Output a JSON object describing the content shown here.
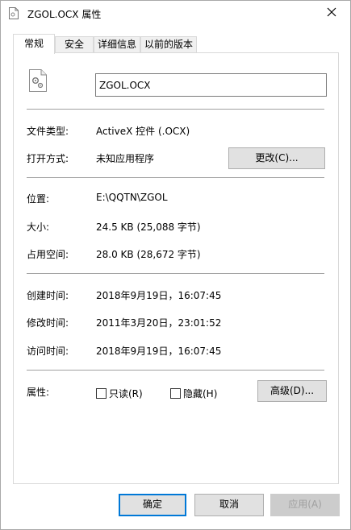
{
  "window": {
    "title": "ZGOL.OCX 属性",
    "close_icon": "close-icon"
  },
  "tabs": [
    {
      "label": "常规",
      "active": true
    },
    {
      "label": "安全",
      "active": false
    },
    {
      "label": "详细信息",
      "active": false
    },
    {
      "label": "以前的版本",
      "active": false
    }
  ],
  "general": {
    "file_icon": "dll-settings-file-icon",
    "file_name": "ZGOL.OCX",
    "type_label": "文件类型:",
    "type_value": "ActiveX 控件 (.OCX)",
    "opens_with_label": "打开方式:",
    "opens_with_value": "未知应用程序",
    "change_button": "更改(C)...",
    "location_label": "位置:",
    "location_value": "E:\\QQTN\\ZGOL",
    "size_label": "大小:",
    "size_value": "24.5 KB (25,088 字节)",
    "size_on_disk_label": "占用空间:",
    "size_on_disk_value": "28.0 KB (28,672 字节)",
    "created_label": "创建时间:",
    "created_value": "2018年9月19日，16:07:45",
    "modified_label": "修改时间:",
    "modified_value": "2011年3月20日，23:01:52",
    "accessed_label": "访问时间:",
    "accessed_value": "2018年9月19日，16:07:45",
    "attributes_label": "属性:",
    "readonly_label": "只读(R)",
    "readonly_checked": false,
    "hidden_label": "隐藏(H)",
    "hidden_checked": false,
    "advanced_button": "高级(D)..."
  },
  "footer": {
    "ok_button": "确定",
    "cancel_button": "取消",
    "apply_button": "应用(A)"
  },
  "colors": {
    "default_button_border": "#0078d7",
    "button_face": "#e1e1e1",
    "disabled_text": "#a0a0a0"
  }
}
